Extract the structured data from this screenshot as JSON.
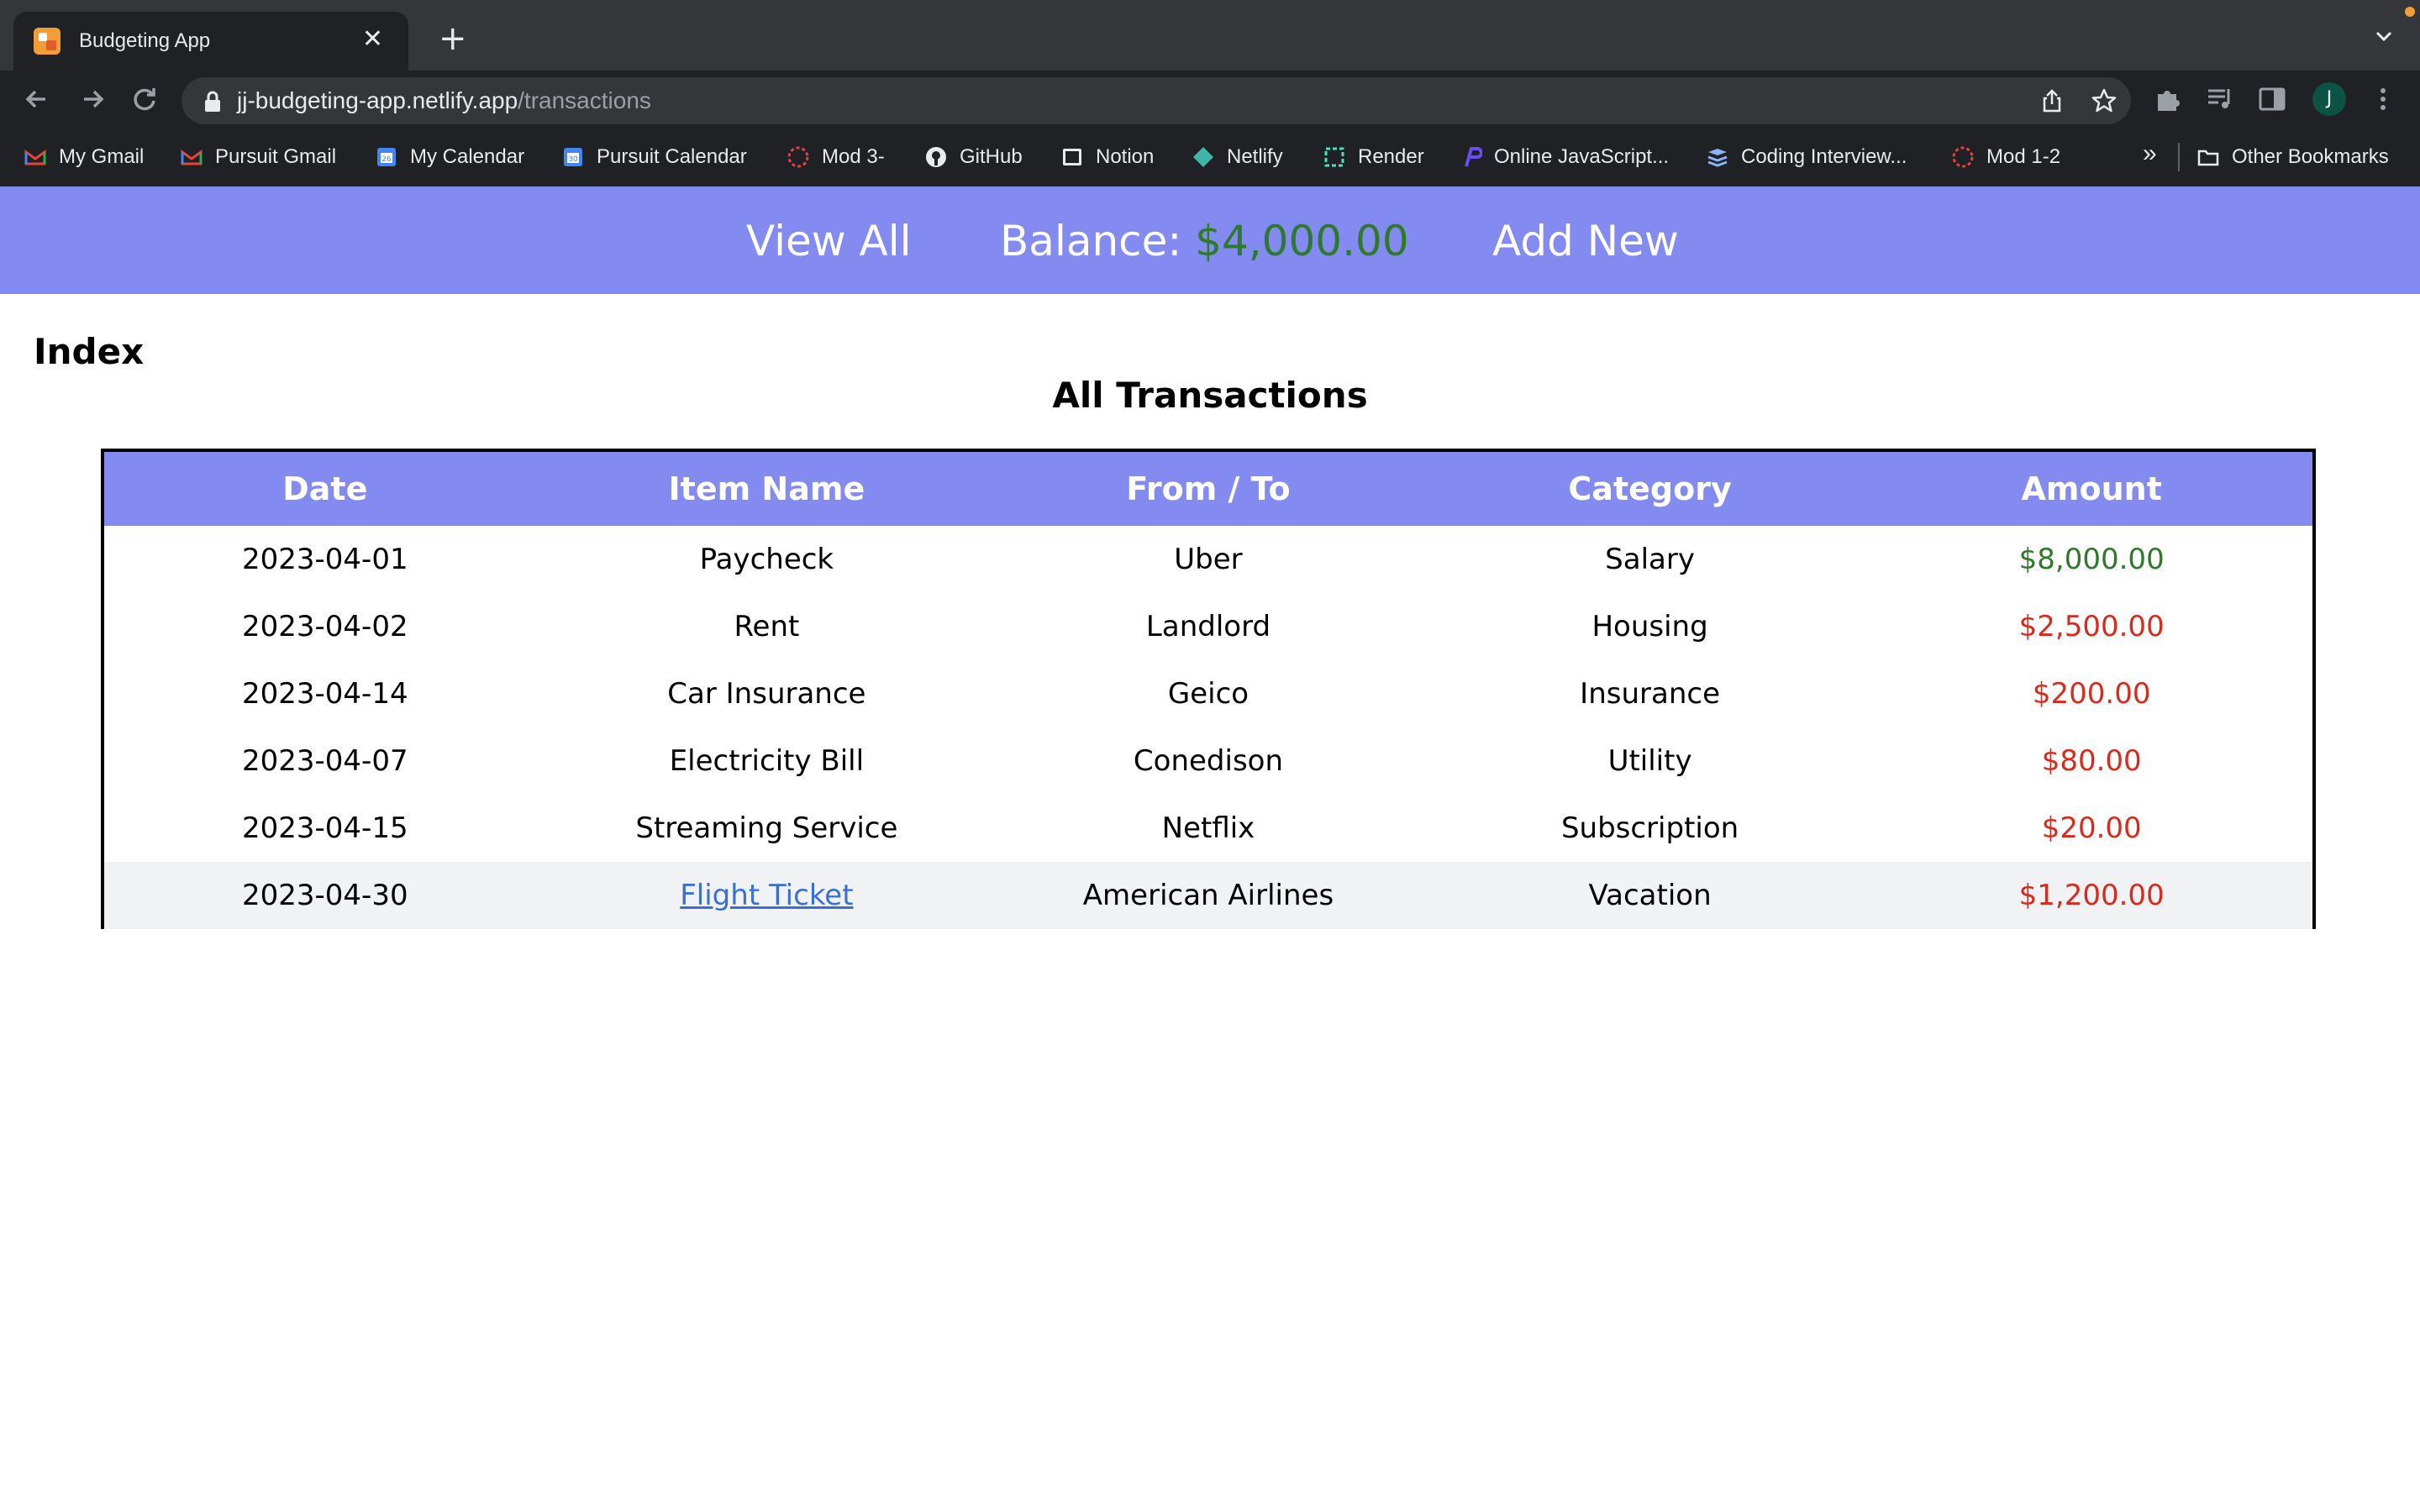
{
  "browser": {
    "tab_title": "Budgeting App",
    "url_host": "jj-budgeting-app.netlify.app",
    "url_path": "/transactions",
    "profile_initial": "J",
    "bookmarks": [
      {
        "label": "My Gmail",
        "icon": "gmail-icon"
      },
      {
        "label": "Pursuit Gmail",
        "icon": "gmail-icon"
      },
      {
        "label": "My Calendar",
        "icon": "calendar-icon"
      },
      {
        "label": "Pursuit Calendar",
        "icon": "calendar-icon"
      },
      {
        "label": "Mod 3-",
        "icon": "pursuit-icon"
      },
      {
        "label": "GitHub",
        "icon": "github-icon"
      },
      {
        "label": "Notion",
        "icon": "notion-icon"
      },
      {
        "label": "Netlify",
        "icon": "netlify-icon"
      },
      {
        "label": "Render",
        "icon": "render-icon"
      },
      {
        "label": "Online JavaScript...",
        "icon": "js-icon"
      },
      {
        "label": "Coding Interview...",
        "icon": "book-icon"
      },
      {
        "label": "Mod 1-2",
        "icon": "pursuit-icon"
      }
    ],
    "more_label": "»",
    "other_bookmarks": "Other Bookmarks"
  },
  "nav": {
    "view_all": "View All",
    "balance_label": "Balance: ",
    "balance_value": "$4,000.00",
    "add_new": "Add New"
  },
  "page": {
    "heading": "Index",
    "subheading": "All Transactions"
  },
  "table": {
    "headers": [
      "Date",
      "Item Name",
      "From / To",
      "Category",
      "Amount"
    ],
    "rows": [
      {
        "date": "2023-04-01",
        "item": "Paycheck",
        "from": "Uber",
        "category": "Salary",
        "amount": "$8,000.00"
      },
      {
        "date": "2023-04-02",
        "item": "Rent",
        "from": "Landlord",
        "category": "Housing",
        "amount": "$2,500.00"
      },
      {
        "date": "2023-04-14",
        "item": "Car Insurance",
        "from": "Geico",
        "category": "Insurance",
        "amount": "$200.00"
      },
      {
        "date": "2023-04-07",
        "item": "Electricity Bill",
        "from": "Conedison",
        "category": "Utility",
        "amount": "$80.00"
      },
      {
        "date": "2023-04-15",
        "item": "Streaming Service",
        "from": "Netflix",
        "category": "Subscription",
        "amount": "$20.00"
      },
      {
        "date": "2023-04-30",
        "item": "Flight Ticket",
        "from": "American Airlines",
        "category": "Vacation",
        "amount": "$1,200.00"
      }
    ]
  },
  "colors": {
    "nav_bg": "#838bf1",
    "positive": "#2f7a2a",
    "negative": "#d82b1e",
    "link": "#3a6fd9"
  }
}
